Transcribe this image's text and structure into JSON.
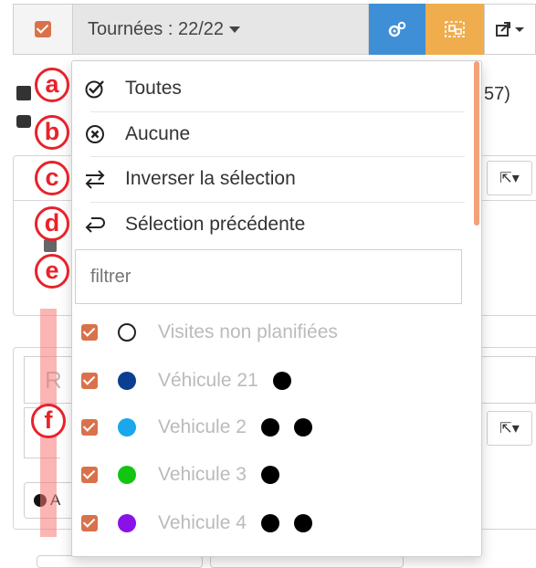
{
  "toolbar": {
    "dropdown_label": "Tournées : 22/22",
    "colors": {
      "blue": "#3f8fd6",
      "orange": "#f0ad4e",
      "checkbox": "#d9724a"
    }
  },
  "background": {
    "row1_right": "57)",
    "input_placeholder": "R",
    "a_label": "A"
  },
  "menu": {
    "items": [
      {
        "label": "Toutes",
        "icon": "check-circle-icon"
      },
      {
        "label": "Aucune",
        "icon": "x-circle-icon"
      },
      {
        "label": "Inverser la sélection",
        "icon": "swap-arrows-icon"
      },
      {
        "label": "Sélection précédente",
        "icon": "return-arrow-icon"
      }
    ],
    "filter_placeholder": "filtrer",
    "vehicles": [
      {
        "label": "Visites non planifiées",
        "color": "#ffffff",
        "dots": 0
      },
      {
        "label": "Véhicule 21",
        "color": "#0b3d91",
        "dots": 1
      },
      {
        "label": "Vehicule 2",
        "color": "#1aa7ec",
        "dots": 2
      },
      {
        "label": "Vehicule 3",
        "color": "#11c511",
        "dots": 1
      },
      {
        "label": "Vehicule 4",
        "color": "#8a11e8",
        "dots": 2
      }
    ]
  },
  "annotations": [
    "a",
    "b",
    "c",
    "d",
    "e",
    "f"
  ]
}
